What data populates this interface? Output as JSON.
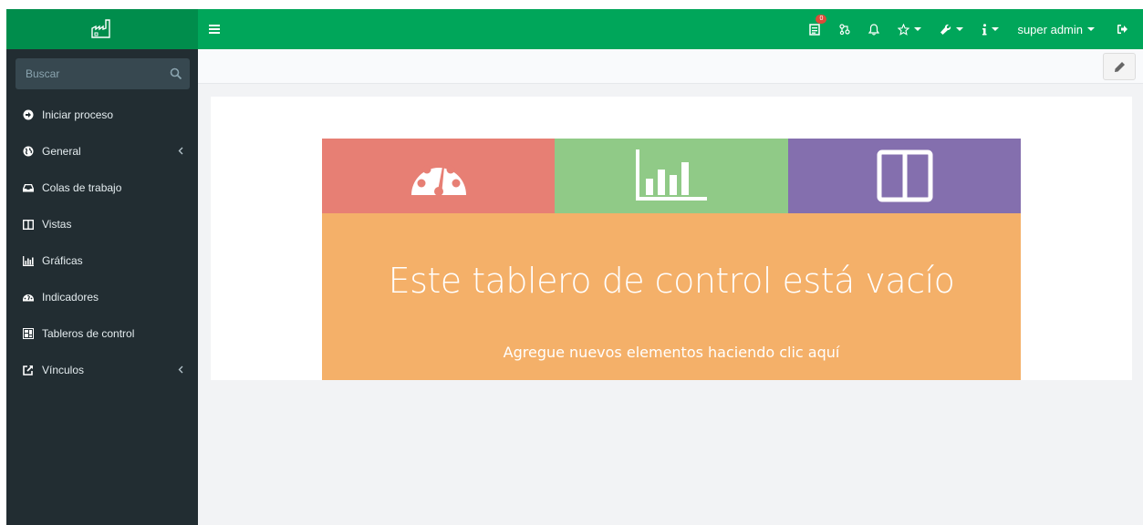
{
  "header": {
    "notification_count": "0",
    "user_name": "super admin"
  },
  "search": {
    "placeholder": "Buscar"
  },
  "sidebar": {
    "items": [
      {
        "label": "Iniciar proceso",
        "icon": "arrow-circle-right-icon"
      },
      {
        "label": "General",
        "icon": "globe-icon",
        "expandable": true
      },
      {
        "label": "Colas de trabajo",
        "icon": "inbox-icon"
      },
      {
        "label": "Vistas",
        "icon": "columns-icon"
      },
      {
        "label": "Gráficas",
        "icon": "bar-chart-icon"
      },
      {
        "label": "Indicadores",
        "icon": "tachometer-icon"
      },
      {
        "label": "Tableros de control",
        "icon": "dashboard-icon"
      },
      {
        "label": "Vínculos",
        "icon": "external-link-icon",
        "expandable": true
      }
    ]
  },
  "empty_state": {
    "title": "Este tablero de control está vacío",
    "subtitle": "Agregue nuevos elementos haciendo clic aquí"
  },
  "colors": {
    "header": "#00a65a",
    "logo_bg": "#008d4c",
    "sidebar": "#222d32",
    "tile_red": "#e77f74",
    "tile_green": "#90ca87",
    "tile_purple": "#846fae",
    "tile_orange": "#f4b069"
  }
}
